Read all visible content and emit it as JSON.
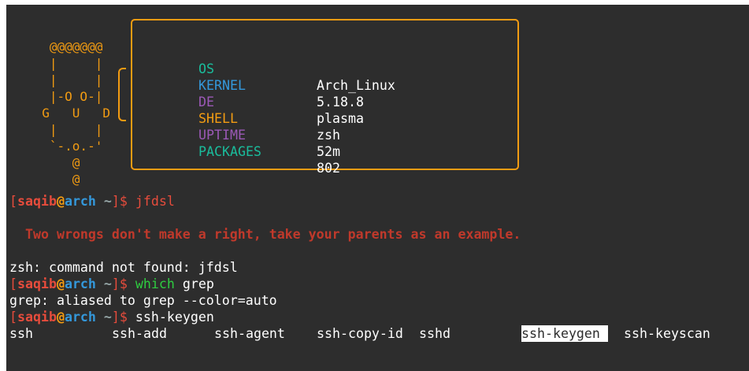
{
  "ascii_art": [
    "   @@@@@@@",
    "   |     |",
    "   |     |",
    "   |-O O-|",
    "  G   U   D",
    "   |     |",
    "   `-.o.-'",
    "      @",
    "      @"
  ],
  "colors": {
    "background": "#2d2d2d",
    "orange": "#f39c12",
    "red": "#e74c3c",
    "blue": "#3498db",
    "teal": "#1abc9c",
    "purple": "#9b59b6",
    "green": "#2ecc40"
  },
  "sysinfo": [
    {
      "key": "OS",
      "value": "Arch_Linux",
      "color": "#1abc9c"
    },
    {
      "key": "KERNEL",
      "value": "5.18.8",
      "color": "#3498db"
    },
    {
      "key": "DE",
      "value": "plasma",
      "color": "#9b59b6"
    },
    {
      "key": "SHELL",
      "value": "zsh",
      "color": "#f39c12"
    },
    {
      "key": "UPTIME",
      "value": "52m",
      "color": "#9b59b6"
    },
    {
      "key": "PACKAGES",
      "value": "802",
      "color": "#1abc9c"
    }
  ],
  "prompt": {
    "open_bracket": "[",
    "user": "saqib",
    "at": "@",
    "host": "arch",
    "dir": "~",
    "close": "]$"
  },
  "commands": {
    "cmd1": "jfdsl",
    "fortune": "Two wrongs don't make a right, take your parents as an example.",
    "error": "zsh: command not found: jfdsl",
    "cmd2_which": "which",
    "cmd2_arg": "grep",
    "output2": "grep: aliased to grep --color=auto",
    "cmd3": "ssh-keygen"
  },
  "completions": [
    "ssh",
    "ssh-add",
    "ssh-agent",
    "ssh-copy-id",
    "sshd",
    "ssh-keygen",
    "ssh-keyscan"
  ]
}
